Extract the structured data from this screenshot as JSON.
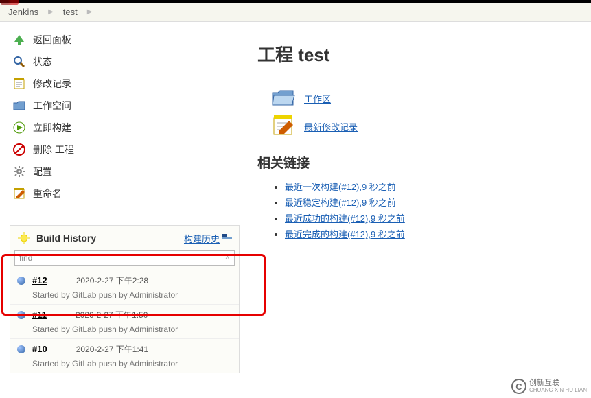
{
  "breadcrumb": {
    "root": "Jenkins",
    "project": "test"
  },
  "sidebar": {
    "items": [
      {
        "label": "返回面板"
      },
      {
        "label": "状态"
      },
      {
        "label": "修改记录"
      },
      {
        "label": "工作空间"
      },
      {
        "label": "立即构建"
      },
      {
        "label": "删除 工程"
      },
      {
        "label": "配置"
      },
      {
        "label": "重命名"
      }
    ]
  },
  "title": "工程 test",
  "quick": {
    "workspace": "工作区",
    "changes": "最新修改记录"
  },
  "section_title": "相关链接",
  "permalinks": [
    "最近一次构建(#12),9 秒之前",
    "最近稳定构建(#12),9 秒之前",
    "最近成功的构建(#12),9 秒之前",
    "最近完成的构建(#12),9 秒之前"
  ],
  "build_history": {
    "title": "Build History",
    "trend": "构建历史",
    "find_value": "find",
    "clear": "x",
    "rows": [
      {
        "id": "#12",
        "date": "2020-2-27 下午2:28",
        "cause": "Started by GitLab push by Administrator"
      },
      {
        "id": "#11",
        "date": "2020-2-27 下午1:50",
        "cause": "Started by GitLab push by Administrator"
      },
      {
        "id": "#10",
        "date": "2020-2-27 下午1:41",
        "cause": "Started by GitLab push by Administrator"
      }
    ]
  },
  "watermark": {
    "brand": "创新互联",
    "pinyin": "CHUANG XIN HU LIAN"
  }
}
